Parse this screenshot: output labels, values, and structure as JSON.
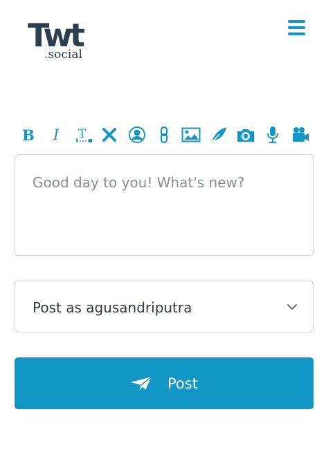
{
  "logo": {
    "main": "Twt",
    "sub": ".social"
  },
  "header": {
    "menu_icon": "hamburger-menu-icon"
  },
  "toolbar": {
    "color": "#1296c5",
    "items": [
      {
        "name": "bold",
        "glyph": "B"
      },
      {
        "name": "italic",
        "glyph": "I"
      },
      {
        "name": "text-format",
        "glyph": "T"
      },
      {
        "name": "clear",
        "icon": "close-icon"
      },
      {
        "name": "mention",
        "icon": "user-circle-icon"
      },
      {
        "name": "link",
        "icon": "link-icon"
      },
      {
        "name": "image",
        "icon": "image-icon"
      },
      {
        "name": "drawing",
        "icon": "feather-icon"
      },
      {
        "name": "camera",
        "icon": "camera-icon"
      },
      {
        "name": "microphone",
        "icon": "microphone-icon"
      },
      {
        "name": "video",
        "icon": "video-camera-icon"
      }
    ]
  },
  "composer": {
    "placeholder": "Good day to you! What's new?",
    "value": ""
  },
  "post_as": {
    "label": "Post as agusandriputra",
    "icon": "chevron-down-icon"
  },
  "post_button": {
    "label": "Post",
    "icon": "paper-plane-icon",
    "color": "#1296c5"
  }
}
